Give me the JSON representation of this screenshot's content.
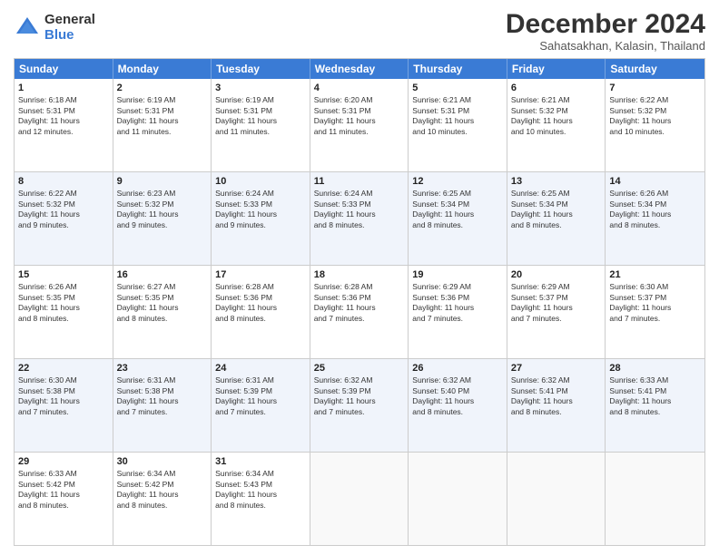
{
  "logo": {
    "general": "General",
    "blue": "Blue"
  },
  "title": "December 2024",
  "subtitle": "Sahatsakhan, Kalasin, Thailand",
  "headers": [
    "Sunday",
    "Monday",
    "Tuesday",
    "Wednesday",
    "Thursday",
    "Friday",
    "Saturday"
  ],
  "weeks": [
    [
      {
        "day": "1",
        "lines": [
          "Sunrise: 6:18 AM",
          "Sunset: 5:31 PM",
          "Daylight: 11 hours",
          "and 12 minutes."
        ]
      },
      {
        "day": "2",
        "lines": [
          "Sunrise: 6:19 AM",
          "Sunset: 5:31 PM",
          "Daylight: 11 hours",
          "and 11 minutes."
        ]
      },
      {
        "day": "3",
        "lines": [
          "Sunrise: 6:19 AM",
          "Sunset: 5:31 PM",
          "Daylight: 11 hours",
          "and 11 minutes."
        ]
      },
      {
        "day": "4",
        "lines": [
          "Sunrise: 6:20 AM",
          "Sunset: 5:31 PM",
          "Daylight: 11 hours",
          "and 11 minutes."
        ]
      },
      {
        "day": "5",
        "lines": [
          "Sunrise: 6:21 AM",
          "Sunset: 5:31 PM",
          "Daylight: 11 hours",
          "and 10 minutes."
        ]
      },
      {
        "day": "6",
        "lines": [
          "Sunrise: 6:21 AM",
          "Sunset: 5:32 PM",
          "Daylight: 11 hours",
          "and 10 minutes."
        ]
      },
      {
        "day": "7",
        "lines": [
          "Sunrise: 6:22 AM",
          "Sunset: 5:32 PM",
          "Daylight: 11 hours",
          "and 10 minutes."
        ]
      }
    ],
    [
      {
        "day": "8",
        "lines": [
          "Sunrise: 6:22 AM",
          "Sunset: 5:32 PM",
          "Daylight: 11 hours",
          "and 9 minutes."
        ]
      },
      {
        "day": "9",
        "lines": [
          "Sunrise: 6:23 AM",
          "Sunset: 5:32 PM",
          "Daylight: 11 hours",
          "and 9 minutes."
        ]
      },
      {
        "day": "10",
        "lines": [
          "Sunrise: 6:24 AM",
          "Sunset: 5:33 PM",
          "Daylight: 11 hours",
          "and 9 minutes."
        ]
      },
      {
        "day": "11",
        "lines": [
          "Sunrise: 6:24 AM",
          "Sunset: 5:33 PM",
          "Daylight: 11 hours",
          "and 8 minutes."
        ]
      },
      {
        "day": "12",
        "lines": [
          "Sunrise: 6:25 AM",
          "Sunset: 5:34 PM",
          "Daylight: 11 hours",
          "and 8 minutes."
        ]
      },
      {
        "day": "13",
        "lines": [
          "Sunrise: 6:25 AM",
          "Sunset: 5:34 PM",
          "Daylight: 11 hours",
          "and 8 minutes."
        ]
      },
      {
        "day": "14",
        "lines": [
          "Sunrise: 6:26 AM",
          "Sunset: 5:34 PM",
          "Daylight: 11 hours",
          "and 8 minutes."
        ]
      }
    ],
    [
      {
        "day": "15",
        "lines": [
          "Sunrise: 6:26 AM",
          "Sunset: 5:35 PM",
          "Daylight: 11 hours",
          "and 8 minutes."
        ]
      },
      {
        "day": "16",
        "lines": [
          "Sunrise: 6:27 AM",
          "Sunset: 5:35 PM",
          "Daylight: 11 hours",
          "and 8 minutes."
        ]
      },
      {
        "day": "17",
        "lines": [
          "Sunrise: 6:28 AM",
          "Sunset: 5:36 PM",
          "Daylight: 11 hours",
          "and 8 minutes."
        ]
      },
      {
        "day": "18",
        "lines": [
          "Sunrise: 6:28 AM",
          "Sunset: 5:36 PM",
          "Daylight: 11 hours",
          "and 7 minutes."
        ]
      },
      {
        "day": "19",
        "lines": [
          "Sunrise: 6:29 AM",
          "Sunset: 5:36 PM",
          "Daylight: 11 hours",
          "and 7 minutes."
        ]
      },
      {
        "day": "20",
        "lines": [
          "Sunrise: 6:29 AM",
          "Sunset: 5:37 PM",
          "Daylight: 11 hours",
          "and 7 minutes."
        ]
      },
      {
        "day": "21",
        "lines": [
          "Sunrise: 6:30 AM",
          "Sunset: 5:37 PM",
          "Daylight: 11 hours",
          "and 7 minutes."
        ]
      }
    ],
    [
      {
        "day": "22",
        "lines": [
          "Sunrise: 6:30 AM",
          "Sunset: 5:38 PM",
          "Daylight: 11 hours",
          "and 7 minutes."
        ]
      },
      {
        "day": "23",
        "lines": [
          "Sunrise: 6:31 AM",
          "Sunset: 5:38 PM",
          "Daylight: 11 hours",
          "and 7 minutes."
        ]
      },
      {
        "day": "24",
        "lines": [
          "Sunrise: 6:31 AM",
          "Sunset: 5:39 PM",
          "Daylight: 11 hours",
          "and 7 minutes."
        ]
      },
      {
        "day": "25",
        "lines": [
          "Sunrise: 6:32 AM",
          "Sunset: 5:39 PM",
          "Daylight: 11 hours",
          "and 7 minutes."
        ]
      },
      {
        "day": "26",
        "lines": [
          "Sunrise: 6:32 AM",
          "Sunset: 5:40 PM",
          "Daylight: 11 hours",
          "and 8 minutes."
        ]
      },
      {
        "day": "27",
        "lines": [
          "Sunrise: 6:32 AM",
          "Sunset: 5:41 PM",
          "Daylight: 11 hours",
          "and 8 minutes."
        ]
      },
      {
        "day": "28",
        "lines": [
          "Sunrise: 6:33 AM",
          "Sunset: 5:41 PM",
          "Daylight: 11 hours",
          "and 8 minutes."
        ]
      }
    ],
    [
      {
        "day": "29",
        "lines": [
          "Sunrise: 6:33 AM",
          "Sunset: 5:42 PM",
          "Daylight: 11 hours",
          "and 8 minutes."
        ]
      },
      {
        "day": "30",
        "lines": [
          "Sunrise: 6:34 AM",
          "Sunset: 5:42 PM",
          "Daylight: 11 hours",
          "and 8 minutes."
        ]
      },
      {
        "day": "31",
        "lines": [
          "Sunrise: 6:34 AM",
          "Sunset: 5:43 PM",
          "Daylight: 11 hours",
          "and 8 minutes."
        ]
      },
      {
        "day": "",
        "lines": []
      },
      {
        "day": "",
        "lines": []
      },
      {
        "day": "",
        "lines": []
      },
      {
        "day": "",
        "lines": []
      }
    ]
  ]
}
